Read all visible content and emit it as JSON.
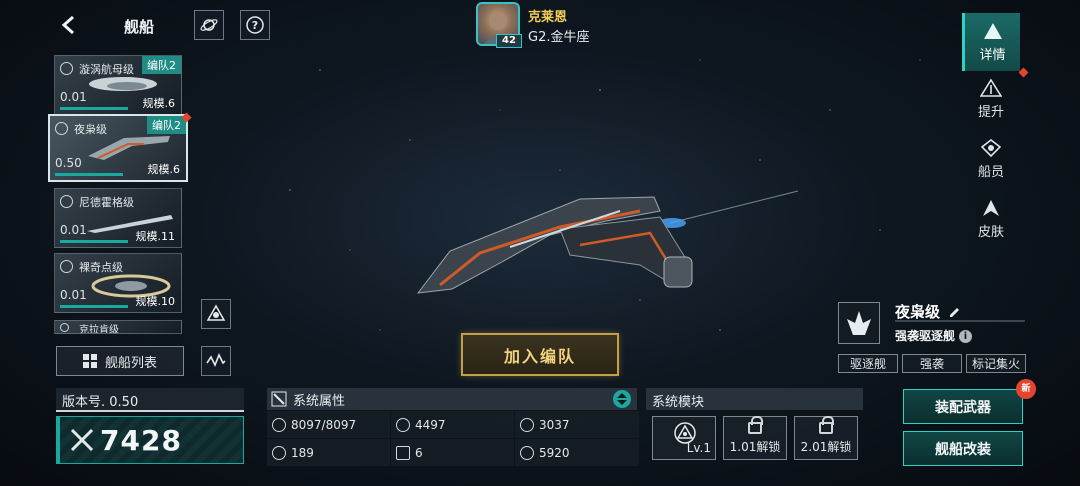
{
  "header": {
    "title": "舰船",
    "back_icon": "chevron-left-icon"
  },
  "player": {
    "name": "克莱恩",
    "rank": "G2.金牛座",
    "level": "42"
  },
  "ship_list": [
    {
      "name": "漩涡航母级",
      "fleet": "编队2",
      "version": "0.01",
      "scale": "规模.6",
      "selected": false
    },
    {
      "name": "夜枭级",
      "fleet": "编队2",
      "version": "0.50",
      "scale": "规模.6",
      "selected": true
    },
    {
      "name": "尼德霍格级",
      "fleet": "",
      "version": "0.01",
      "scale": "规模.11",
      "selected": false
    },
    {
      "name": "裸奇点级",
      "fleet": "",
      "version": "0.01",
      "scale": "规模.10",
      "selected": false
    },
    {
      "name": "克拉肯级",
      "fleet": "",
      "version": "",
      "scale": "",
      "selected": false
    }
  ],
  "ship_list_button": "舰船列表",
  "version_label": "版本号. 0.50",
  "power": "7428",
  "join_button": "加入编队",
  "attributes": {
    "title": "系统属性",
    "cells": [
      {
        "icon": "hull-icon",
        "value": "8097/8097"
      },
      {
        "icon": "armor-icon",
        "value": "4497"
      },
      {
        "icon": "shield-icon",
        "value": "3037"
      },
      {
        "icon": "speed-icon",
        "value": "189"
      },
      {
        "icon": "grid-icon",
        "value": "6"
      },
      {
        "icon": "target-icon",
        "value": "5920"
      }
    ]
  },
  "modules": {
    "title": "系统模块",
    "slots": [
      {
        "label": "Lv.1",
        "locked": false
      },
      {
        "label": "1.01解锁",
        "locked": true
      },
      {
        "label": "2.01解锁",
        "locked": true
      }
    ]
  },
  "right_tabs": [
    {
      "label": "详情",
      "active": true
    },
    {
      "label": "提升",
      "active": false
    },
    {
      "label": "船员",
      "active": false
    },
    {
      "label": "皮肤",
      "active": false
    }
  ],
  "ship_info": {
    "name": "夜枭级",
    "type": "强袭驱逐舰",
    "tags": [
      "驱逐舰",
      "强袭",
      "标记集火"
    ]
  },
  "buttons": {
    "equip": "装配武器",
    "modify": "舰船改装",
    "new_badge": "新"
  },
  "colors": {
    "accent": "#1aa99f",
    "gold": "#c4a045",
    "alert": "#e5452e"
  }
}
